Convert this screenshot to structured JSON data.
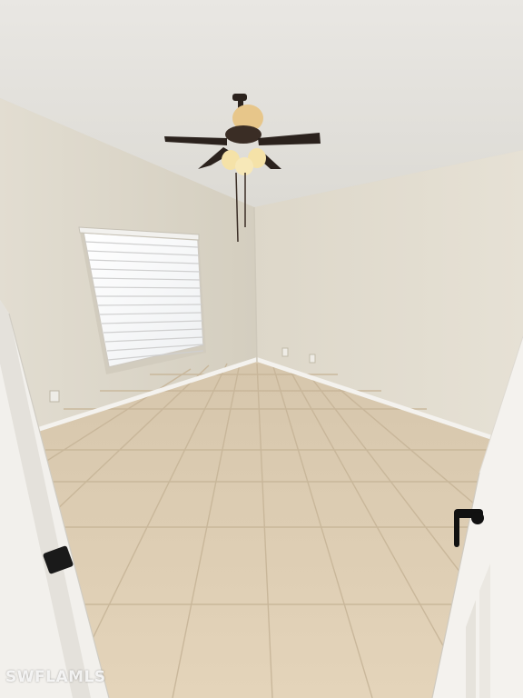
{
  "photo": {
    "subject": "empty-room-with-ceiling-fan",
    "watermark": "SWFLAMLS"
  },
  "colors": {
    "ceiling": "#e8e6e1",
    "left_wall": "#dcd6c8",
    "back_wall": "#e3ddd0",
    "floor_tile": "#dccab0",
    "grout": "#c9b89c",
    "baseboard": "#f3f1ec",
    "fan_blade": "#2b221d",
    "door": "#f4f2ee",
    "handle": "#111111"
  },
  "icons": {
    "fan": "ceiling-fan-icon",
    "window": "window-blinds-icon",
    "door_handle": "lever-handle-icon"
  }
}
